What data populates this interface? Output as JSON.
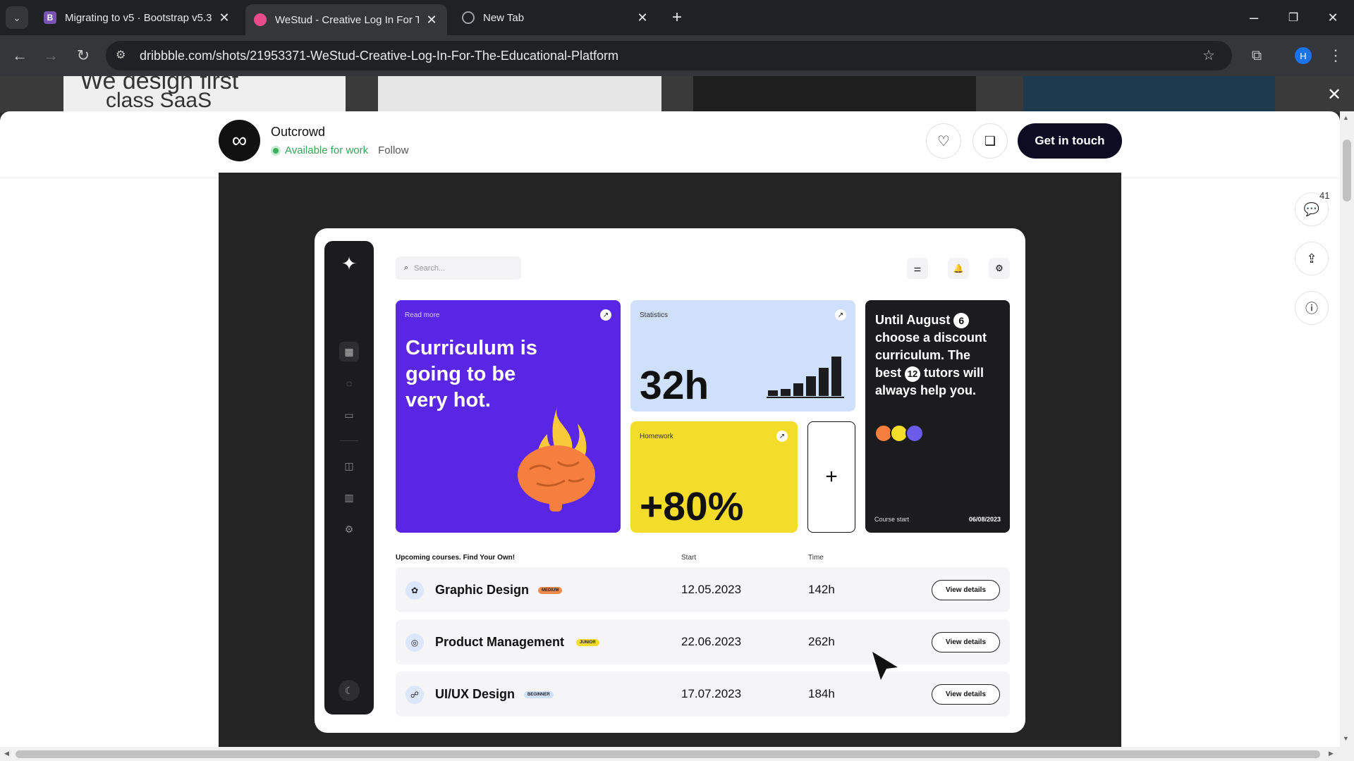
{
  "browser": {
    "tabs": [
      {
        "title": "Migrating to v5 · Bootstrap v5.3",
        "favicon": "B",
        "favicon_color": "#7952b3"
      },
      {
        "title": "WeStud - Creative Log In For Th",
        "favicon": "",
        "favicon_color": "#ea4c89"
      },
      {
        "title": "New Tab",
        "favicon": "",
        "favicon_color": "#9aa0a6"
      }
    ],
    "url": "dribbble.com/shots/21953371-WeStud-Creative-Log-In-For-The-Educational-Platform",
    "profile_initial": "H"
  },
  "thumbs": {
    "first_text_line1": "We design first",
    "first_text_line2": "class SaaS"
  },
  "shot_header": {
    "author": "Outcrowd",
    "availability": "Available for work",
    "follow_label": "Follow",
    "cta_label": "Get in touch"
  },
  "right_rail": {
    "comments_count": "41"
  },
  "app": {
    "search_placeholder": "Search...",
    "tile_curriculum": {
      "kicker": "Read more",
      "headline_1": "Curriculum is",
      "headline_2": "going to be",
      "headline_3": "very hot.",
      "color": "#5a26e6"
    },
    "tile_stats": {
      "kicker": "Statistics",
      "value": "32h",
      "color": "#cfe0fc"
    },
    "tile_homework": {
      "kicker": "Homework",
      "value": "+80%",
      "color": "#f3dc2a"
    },
    "tile_promo": {
      "line1": "Until August",
      "badge1": "6",
      "line2": "choose a discount",
      "line3": "curriculum. The",
      "line4a": "best",
      "badge2": "12",
      "line4b": "tutors will",
      "line5": "always help you.",
      "footer_left": "Course start",
      "footer_right": "06/08/2023"
    },
    "table": {
      "heading": "Upcoming courses. Find Your Own!",
      "col_start": "Start",
      "col_time": "Time",
      "rows": [
        {
          "name": "Graphic Design",
          "tag": "MEDIUM",
          "tag_color": "#f08a4b",
          "start": "12.05.2023",
          "time": "142h",
          "action": "View details"
        },
        {
          "name": "Product Management",
          "tag": "JUNIOR",
          "tag_color": "#f3dc2a",
          "start": "22.06.2023",
          "time": "262h",
          "action": "View details"
        },
        {
          "name": "UI/UX Design",
          "tag": "BEGINNER",
          "tag_color": "#cfe0fc",
          "start": "17.07.2023",
          "time": "184h",
          "action": "View details"
        }
      ]
    }
  }
}
